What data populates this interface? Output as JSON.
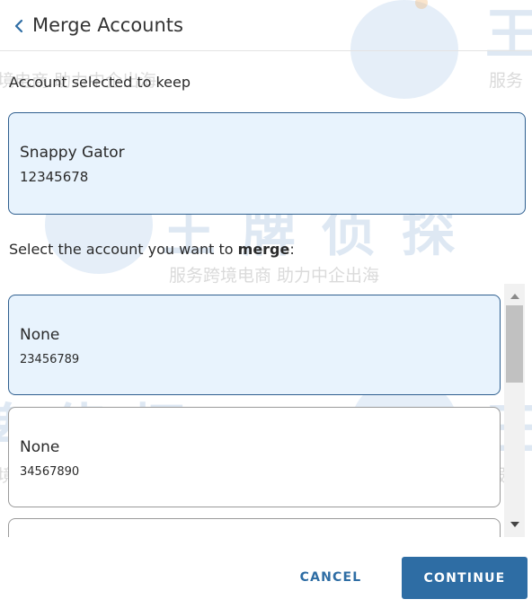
{
  "header": {
    "title": "Merge Accounts",
    "back_icon": "chevron-left-icon"
  },
  "kept": {
    "label": "Account selected to keep",
    "account": {
      "name": "Snappy Gator",
      "number": "12345678"
    }
  },
  "merge": {
    "label_prefix": "Select the account you want to ",
    "label_emphasis": "merge",
    "label_suffix": ":",
    "accounts": [
      {
        "name": "None",
        "number": "23456789",
        "selected": true
      },
      {
        "name": "None",
        "number": "34567890",
        "selected": false
      },
      {
        "name": "",
        "number": "",
        "selected": false
      }
    ]
  },
  "actions": {
    "cancel_label": "CANCEL",
    "continue_label": "CONTINUE"
  },
  "colors": {
    "accent": "#2e6da4",
    "selected_bg": "#e8f3fd",
    "selected_border": "#2f5f8f"
  },
  "watermark": {
    "brand": "王 牌 侦 探",
    "tagline": "服务跨境电商 助力中企出海",
    "tagline_short": "服务",
    "brand_short": "王"
  }
}
